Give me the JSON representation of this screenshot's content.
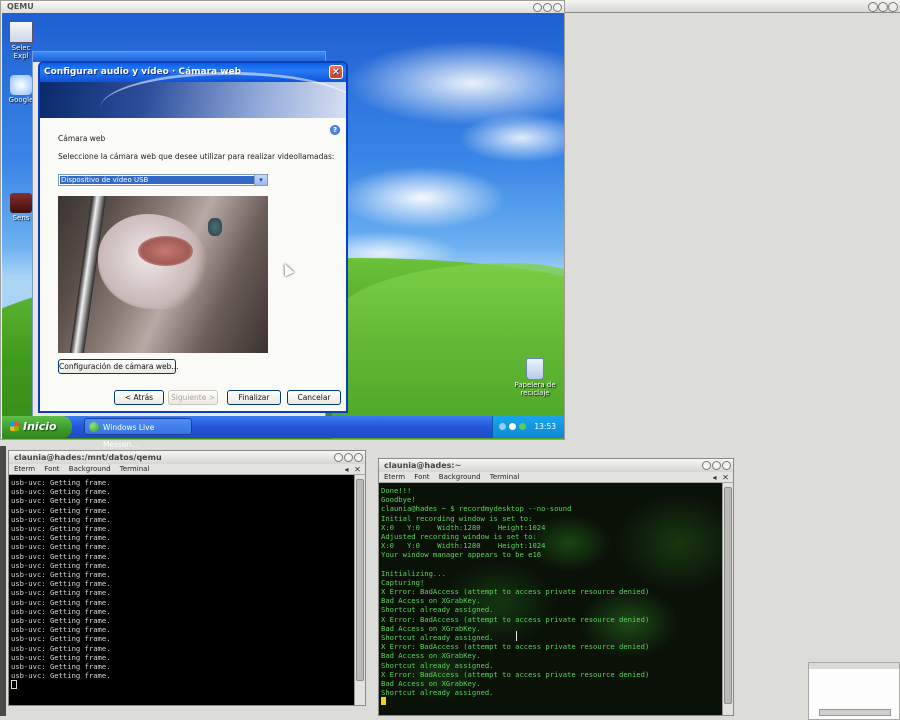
{
  "qemu": {
    "title": "QEMU"
  },
  "desktop": {
    "icons": [
      {
        "label": "Selec\nExpl"
      },
      {
        "label": "Google"
      },
      {
        "label": "Sens"
      }
    ],
    "recycle_bin_label": "Papelera de reciclaje"
  },
  "taskbar": {
    "start_label": "Inicio",
    "task_label": "Windows Live Messen...",
    "clock": "13:53"
  },
  "dialog": {
    "title": "Configurar audio y vídeo · Cámara web",
    "close_glyph": "✕",
    "help_glyph": "?",
    "section_label": "Cámara web",
    "instruction": "Seleccione la cámara web que desee utilizar para realizar videollamadas:",
    "camera_selected": "Dispositivo de vídeo USB",
    "settings_button": "Configuración de cámara web...",
    "back_button": "< Atrás",
    "next_button": "Siguiente >",
    "finish_button": "Finalizar",
    "cancel_button": "Cancelar"
  },
  "terminal1": {
    "title": "claunia@hades:/mnt/datos/qemu",
    "menu": [
      "Eterm",
      "Font",
      "Background",
      "Terminal"
    ],
    "lines": [
      "usb-uvc: Getting frame.",
      "usb-uvc: Getting frame.",
      "usb-uvc: Getting frame.",
      "usb-uvc: Getting frame.",
      "usb-uvc: Getting frame.",
      "usb-uvc: Getting frame.",
      "usb-uvc: Getting frame.",
      "usb-uvc: Getting frame.",
      "usb-uvc: Getting frame.",
      "usb-uvc: Getting frame.",
      "usb-uvc: Getting frame.",
      "usb-uvc: Getting frame.",
      "usb-uvc: Getting frame.",
      "usb-uvc: Getting frame.",
      "usb-uvc: Getting frame.",
      "usb-uvc: Getting frame.",
      "usb-uvc: Getting frame.",
      "usb-uvc: Getting frame.",
      "usb-uvc: Getting frame.",
      "usb-uvc: Getting frame.",
      "usb-uvc: Getting frame.",
      "usb-uvc: Getting frame."
    ]
  },
  "terminal2": {
    "title": "claunia@hades:~",
    "menu": [
      "Eterm",
      "Font",
      "Background",
      "Terminal"
    ],
    "lines": [
      "Done!!!",
      "Goodbye!",
      "claunia@hades ~ $ recordmydesktop --no-sound",
      "Initial recording window is set to:",
      "X:0   Y:0    Width:1280    Height:1024",
      "Adjusted recording window is set to:",
      "X:0   Y:0    Width:1280    Height:1024",
      "Your window manager appears to be e16",
      "",
      "Initializing...",
      "Capturing!",
      "X Error: BadAccess (attempt to access private resource denied)",
      "Bad Access on XGrabKey.",
      "Shortcut already assigned.",
      "X Error: BadAccess (attempt to access private resource denied)",
      "Bad Access on XGrabKey.",
      "Shortcut already assigned.",
      "X Error: BadAccess (attempt to access private resource denied)",
      "Bad Access on XGrabKey.",
      "Shortcut already assigned.",
      "X Error: BadAccess (attempt to access private resource denied)",
      "Bad Access on XGrabKey.",
      "Shortcut already assigned."
    ]
  },
  "colors": {
    "xp_titlebar": "#0a5fe8",
    "term2_text": "#5bd35b",
    "cursor_block": "#f2d21a"
  }
}
